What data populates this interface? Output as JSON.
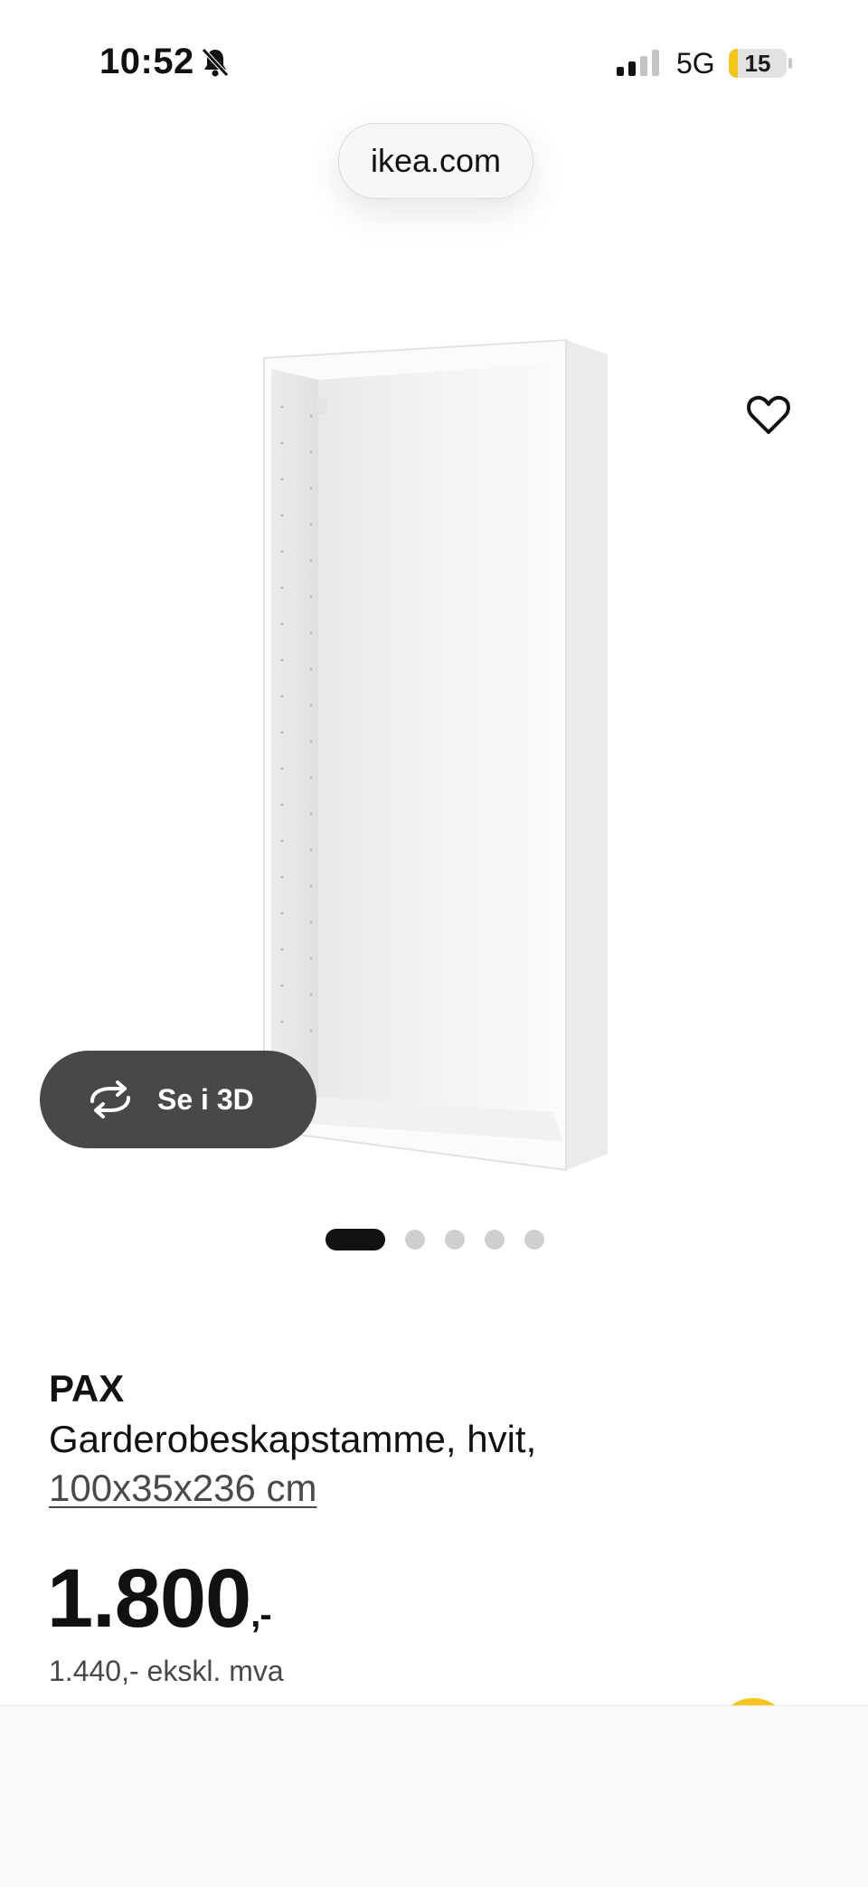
{
  "status_bar": {
    "time": "10:52",
    "network": "5G",
    "battery_level": "15",
    "battery_percent": 15
  },
  "browser": {
    "url": "ikea.com"
  },
  "gallery": {
    "view_3d_label": "Se i 3D",
    "dot_count": 5,
    "active_dot": 0
  },
  "product": {
    "brand": "PAX",
    "description": "Garderobeskapstamme, hvit,",
    "size": "100x35x236 cm",
    "price_main": "1.800",
    "price_suffix": ",-",
    "price_ex_vat": "1.440,- ekskl. mva"
  },
  "colors": {
    "accent": "#f5c518",
    "button_dark": "#484848"
  }
}
